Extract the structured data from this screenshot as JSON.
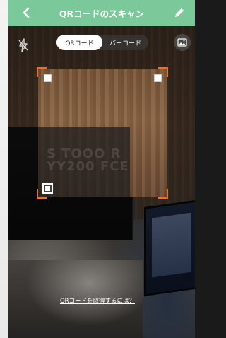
{
  "header": {
    "title": "QRコードのスキャン",
    "back_icon": "chevron-left-icon",
    "edit_icon": "pencil-icon",
    "background_color": "#7bc99a"
  },
  "toolbar": {
    "flash_icon": "flash-off-icon",
    "modes": [
      {
        "label": "QRコード",
        "selected": true
      },
      {
        "label": "バーコード",
        "selected": false
      }
    ],
    "gallery_icon": "image-icon"
  },
  "scanner": {
    "corner_color": "#ff6a1a",
    "camera_ghost_text": "S TOOO R\nYY200 FCE"
  },
  "footer": {
    "help_link": "QRコードを取得するには？"
  }
}
